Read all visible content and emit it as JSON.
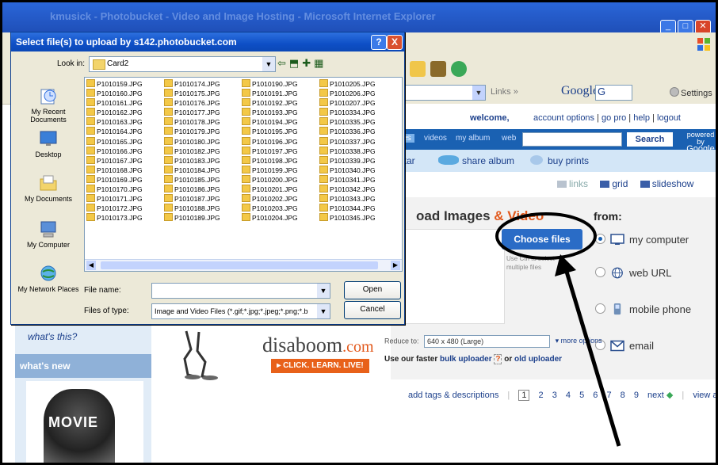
{
  "browser": {
    "title": "kmusick - Photobucket - Video and Image Hosting - Microsoft Internet Explorer",
    "links_label": "Links",
    "google_label": "Google",
    "google_g": "G",
    "settings_label": "Settings"
  },
  "pb": {
    "welcome": "welcome,",
    "account_text": "account options",
    "go_pro": "go pro",
    "help": "help",
    "logout": "logout",
    "tabs": [
      "ages",
      "videos",
      "my album",
      "web"
    ],
    "search_button": "Search",
    "powered_by": "powered by",
    "powered_brand": "Google",
    "avatar_label": "vatar",
    "share_album": "share album",
    "buy_prints": "buy prints",
    "views": {
      "links": "links",
      "grid": "grid",
      "slideshow": "slideshow"
    },
    "upload": {
      "title_a": "oad Images",
      "title_amp": "&",
      "title_b": "Video",
      "choose_files": "Choose files",
      "hint": "Use Ctrl to select multiple files",
      "from_label": "from:",
      "sources": [
        "my computer",
        "web URL",
        "mobile phone",
        "email"
      ],
      "reduce_label": "Reduce to:",
      "reduce_value": "640 x 480 (Large)",
      "more_options": "more options",
      "faster_a": "Use our faster",
      "bulk_uploader": "bulk uploader",
      "or": "or",
      "old_uploader": "old uploader"
    },
    "tags": "add tags & descriptions",
    "pages": [
      "1",
      "2",
      "3",
      "4",
      "5",
      "6",
      "7",
      "8",
      "9"
    ],
    "next": "next",
    "view_all": "view all",
    "whats_this": "what's this?",
    "whats_new": "what's new",
    "movie_text": "MOVIE"
  },
  "ad": {
    "logo": "disaboom",
    "logo_com": ".com",
    "cta": "▸ CLICK. LEARN. LIVE!"
  },
  "dialog": {
    "title": "Select file(s) to upload by s142.photobucket.com",
    "help": "?",
    "close": "X",
    "look_in_label": "Look in:",
    "look_in_value": "Card2",
    "places": [
      "My Recent Documents",
      "Desktop",
      "My Documents",
      "My Computer",
      "My Network Places"
    ],
    "files": [
      [
        "P1010159.JPG",
        "P1010160.JPG",
        "P1010161.JPG",
        "P1010162.JPG",
        "P1010163.JPG",
        "P1010164.JPG",
        "P1010165.JPG",
        "P1010166.JPG",
        "P1010167.JPG",
        "P1010168.JPG",
        "P1010169.JPG",
        "P1010170.JPG",
        "P1010171.JPG",
        "P1010172.JPG",
        "P1010173.JPG"
      ],
      [
        "P1010174.JPG",
        "P1010175.JPG",
        "P1010176.JPG",
        "P1010177.JPG",
        "P1010178.JPG",
        "P1010179.JPG",
        "P1010180.JPG",
        "P1010182.JPG",
        "P1010183.JPG",
        "P1010184.JPG",
        "P1010185.JPG",
        "P1010186.JPG",
        "P1010187.JPG",
        "P1010188.JPG",
        "P1010189.JPG"
      ],
      [
        "P1010190.JPG",
        "P1010191.JPG",
        "P1010192.JPG",
        "P1010193.JPG",
        "P1010194.JPG",
        "P1010195.JPG",
        "P1010196.JPG",
        "P1010197.JPG",
        "P1010198.JPG",
        "P1010199.JPG",
        "P1010200.JPG",
        "P1010201.JPG",
        "P1010202.JPG",
        "P1010203.JPG",
        "P1010204.JPG"
      ],
      [
        "P1010205.JPG",
        "P1010206.JPG",
        "P1010207.JPG",
        "P1010334.JPG",
        "P1010335.JPG",
        "P1010336.JPG",
        "P1010337.JPG",
        "P1010338.JPG",
        "P1010339.JPG",
        "P1010340.JPG",
        "P1010341.JPG",
        "P1010342.JPG",
        "P1010343.JPG",
        "P1010344.JPG",
        "P1010345.JPG"
      ]
    ],
    "file_name_label": "File name:",
    "file_name_value": "",
    "files_of_type_label": "Files of type:",
    "files_of_type_value": "Image and Video Files (*.gif;*.jpg;*.jpeg;*.png;*.b",
    "open_button": "Open",
    "cancel_button": "Cancel"
  }
}
